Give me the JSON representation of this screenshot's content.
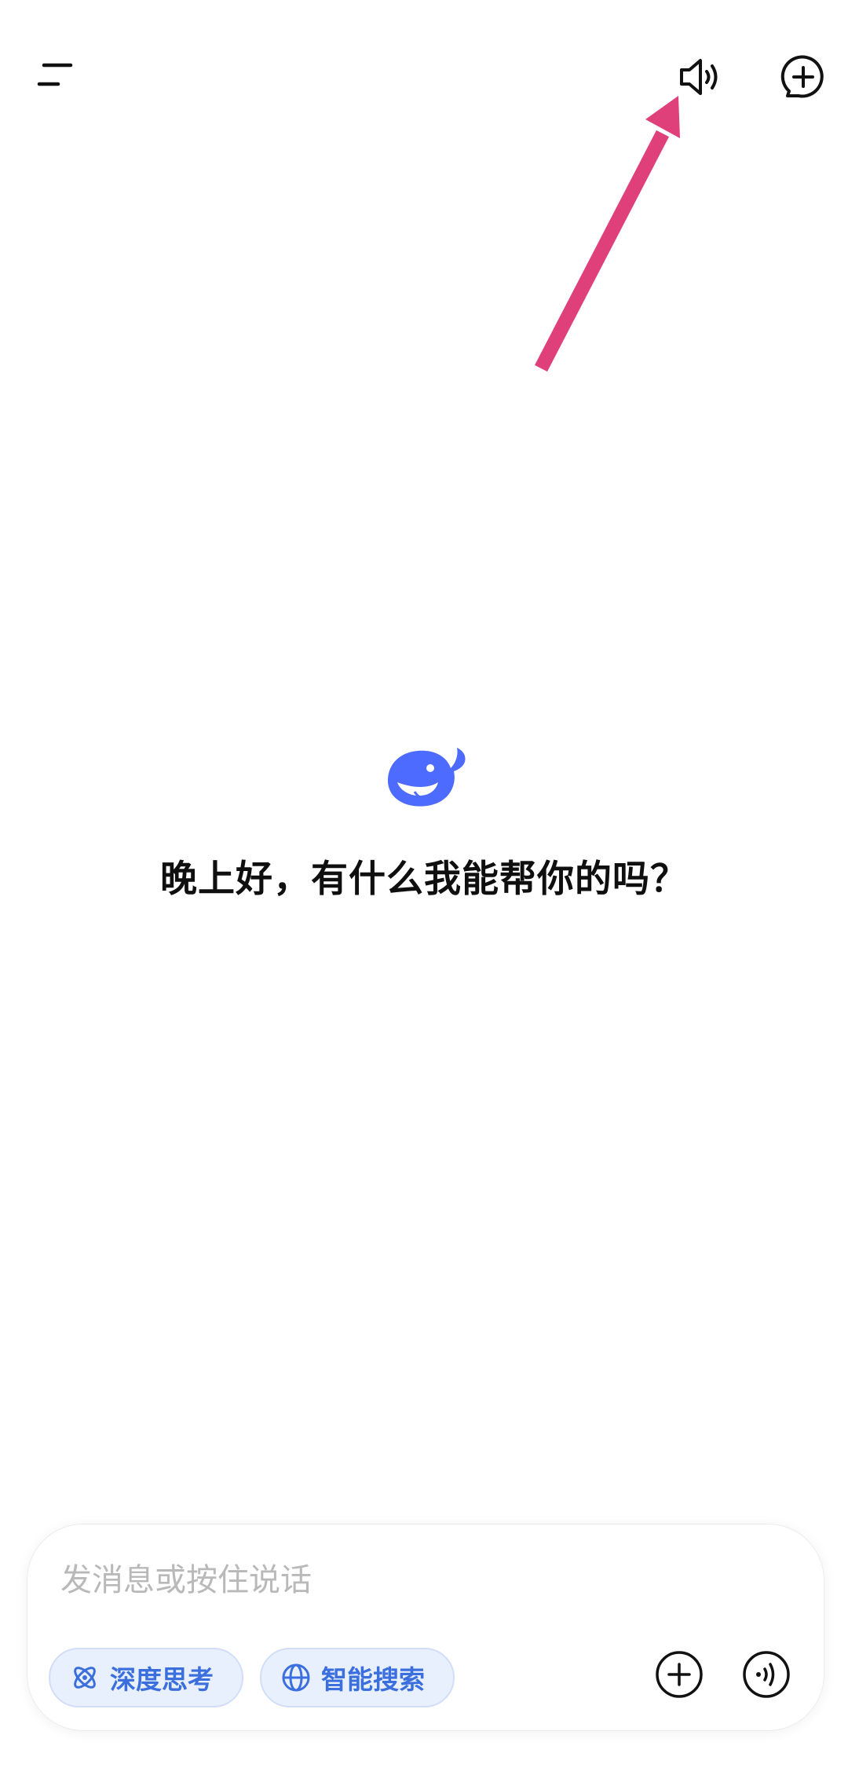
{
  "header": {
    "menu_icon": "menu-icon",
    "speaker_icon": "speaker-icon",
    "new_chat_icon": "new-chat-icon"
  },
  "main": {
    "logo_icon": "deepseek-whale-logo",
    "greeting": "晚上好，有什么我能帮你的吗？"
  },
  "composer": {
    "placeholder": "发消息或按住说话",
    "value": "",
    "chips": [
      {
        "label": "深度思考",
        "icon": "atom-icon"
      },
      {
        "label": "智能搜索",
        "icon": "globe-icon"
      }
    ],
    "attach_icon": "plus-circle-icon",
    "voice_icon": "voice-wave-icon"
  },
  "colors": {
    "accent": "#4d6bfe",
    "chip_text": "#3c6fde",
    "chip_bg": "#e8f0fd",
    "annotation_arrow": "#e0407a"
  }
}
